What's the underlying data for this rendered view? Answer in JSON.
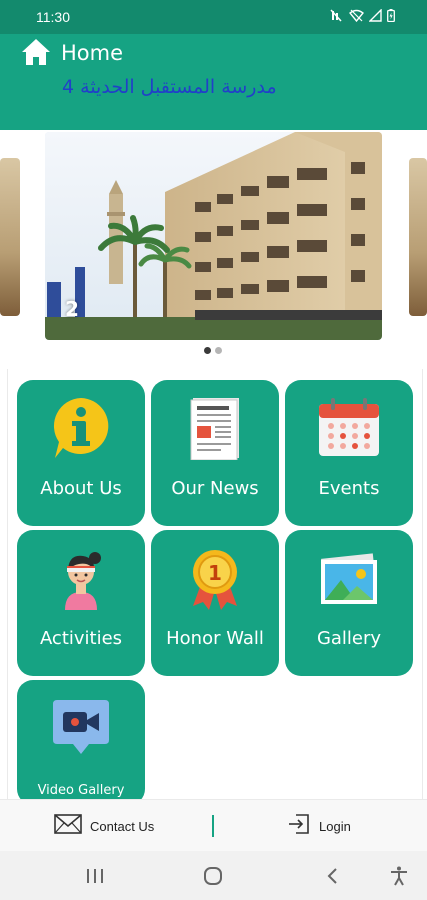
{
  "status_bar": {
    "time": "11:30",
    "icons": [
      "mute-icon",
      "wifi-icon",
      "signal-icon",
      "battery-icon"
    ]
  },
  "header": {
    "title": "Home",
    "school_name": "مدرسة المستقبل الحديثة 4",
    "icon": "home-icon"
  },
  "carousel": {
    "current_slide_number": "2",
    "slide_count": 2,
    "active_index": 0
  },
  "menu": {
    "items": [
      {
        "label": "About Us",
        "icon": "info-icon"
      },
      {
        "label": "Our News",
        "icon": "newspaper-icon"
      },
      {
        "label": "Events",
        "icon": "calendar-icon"
      },
      {
        "label": "Activities",
        "icon": "student-icon"
      },
      {
        "label": "Honor Wall",
        "icon": "medal-icon"
      },
      {
        "label": "Gallery",
        "icon": "photo-icon"
      },
      {
        "label": "Video Gallery",
        "icon": "video-camera-icon"
      }
    ]
  },
  "bottom_bar": {
    "contact_label": "Contact Us",
    "login_label": "Login"
  },
  "colors": {
    "primary": "#16a383",
    "status_bar": "#138a6d",
    "school_name": "#2140c9"
  }
}
